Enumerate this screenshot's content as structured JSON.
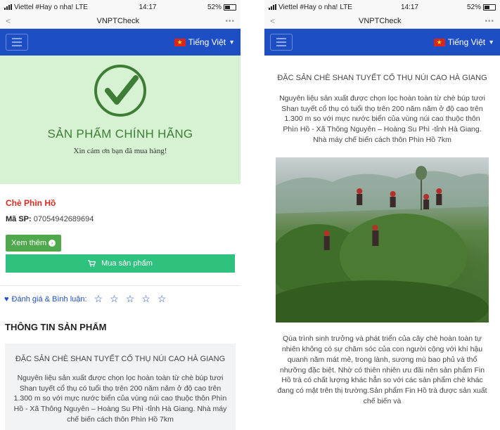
{
  "status": {
    "carrier": "Viettel #Hay o nha!",
    "network": "LTE",
    "time": "14:17",
    "battery": "52%"
  },
  "browser": {
    "back": "<",
    "title": "VNPTCheck",
    "more": "•••"
  },
  "nav": {
    "language": "Tiếng Việt"
  },
  "hero": {
    "title": "SẢN PHẨM CHÍNH HÃNG",
    "subtitle": "Xin cảm ơn bạn đã mua hàng!"
  },
  "product": {
    "name": "Chè Phìn Hồ",
    "code_label": "Mã SP:",
    "code_value": "07054942689694"
  },
  "buttons": {
    "more": "Xem thêm",
    "buy": "Mua sản phẩm"
  },
  "rating": {
    "label": "Đánh giá & Bình luận:",
    "stars": 5
  },
  "section": {
    "title": "THÔNG TIN SẢN PHẨM"
  },
  "info": {
    "heading": "ĐẶC SẢN CHÈ SHAN TUYẾT CỔ THỤ NÚI CAO HÀ GIANG",
    "paragraph1": "Nguyên liệu sản xuất được chọn lọc hoàn toàn từ chè búp tươi Shan tuyết cổ thụ có tuổi thọ trên 200 năm năm ở độ cao trên 1.300 m so với mực nước biển của vùng núi cao thuộc thôn Phìn Hồ - Xã Thông Nguyên – Hoàng Su Phì -tỉnh Hà Giang. Nhà máy chế biến cách thôn Phìn Hồ 7km",
    "paragraph2": "Qúa trình sinh trưởng và phát triển của cây chè hoàn toàn tự nhiên không có sự chăm sóc của con người cộng với khí hậu quanh năm mát mẻ, trong lành, sương mù bao phủ và thổ nhưỡng đặc biệt. Nhờ có thiên nhiên ưu đãi nên sản phẩm Fin Hồ trà có chất lượng khác hẳn so với các sản phẩm chè khác đang có mặt trên thị trường.Sản phẩm Fin Hồ trà được sản xuất chế biến và"
  },
  "colors": {
    "navbar": "#1e4ec3",
    "hero_bg": "#d7f2d3",
    "check": "#3d7d35",
    "product_name": "#e02a20",
    "more_button": "#4fa84b",
    "buy_button": "#2ec27e"
  }
}
